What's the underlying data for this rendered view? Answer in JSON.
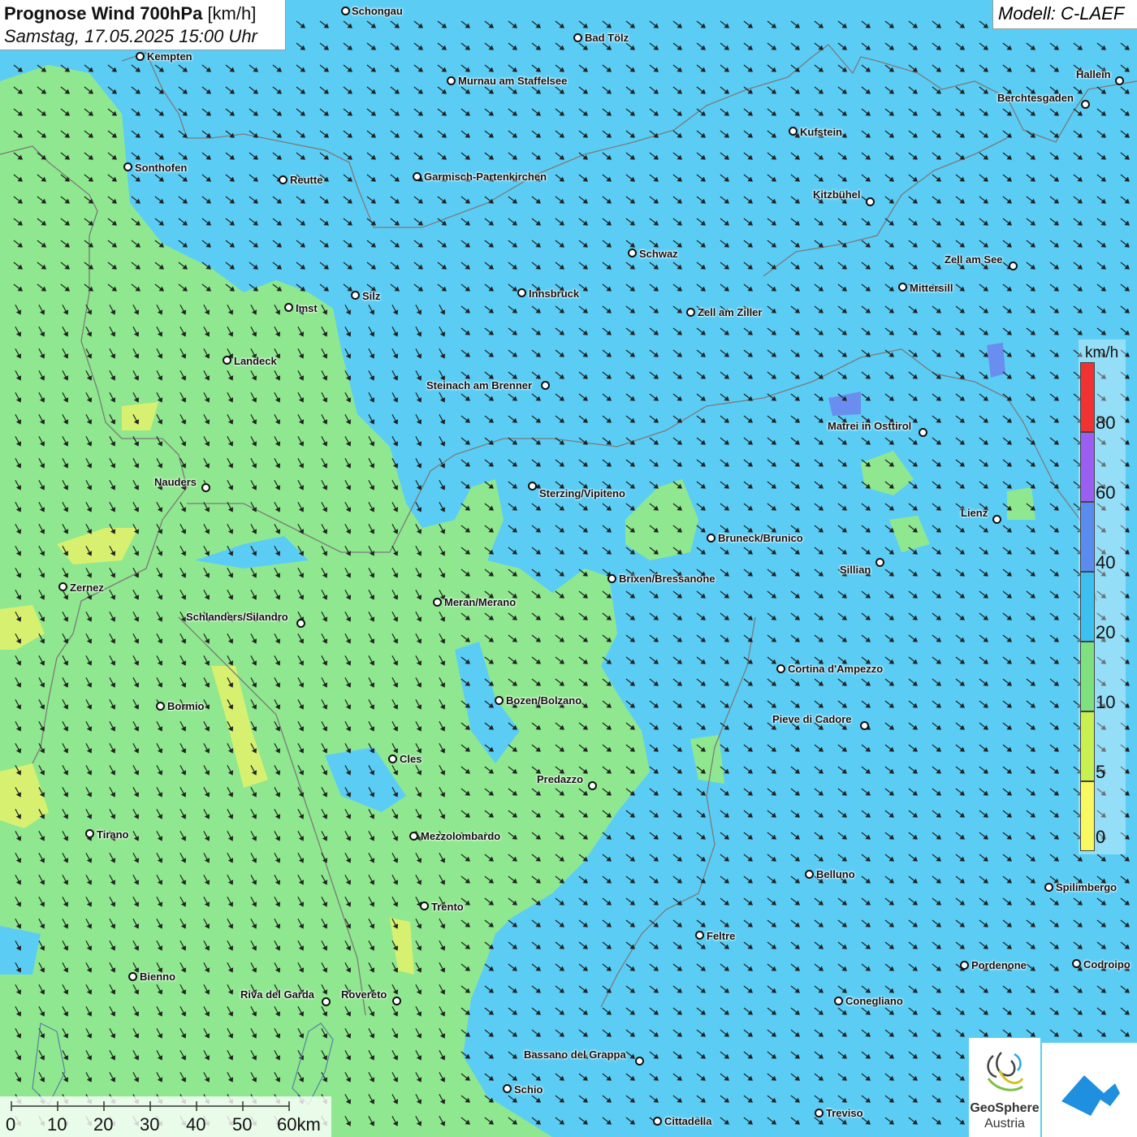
{
  "header": {
    "title_bold": "Prognose Wind 700hPa",
    "title_unit": "[km/h]",
    "datetime": "Samstag, 17.05.2025 15:00 Uhr",
    "model": "Modell: C-LAEF"
  },
  "legend": {
    "unit": "km/h",
    "ticks": [
      "80",
      "60",
      "40",
      "20",
      "10",
      "5",
      "0"
    ],
    "colors": [
      "#f03232",
      "#9a5ef0",
      "#5a8cf0",
      "#3cc0f0",
      "#7fe07f",
      "#c8f050",
      "#f8f860"
    ]
  },
  "scale": {
    "labels": [
      "0",
      "10",
      "20",
      "30",
      "40",
      "50",
      "60km"
    ]
  },
  "logos": {
    "geosphere_line1": "GeoSphere",
    "geosphere_line2": "Austria"
  },
  "cities": [
    {
      "name": "Schongau"
    },
    {
      "name": "Bad Tölz"
    },
    {
      "name": "Kempten"
    },
    {
      "name": "Murnau am Staffelsee"
    },
    {
      "name": "Hallein"
    },
    {
      "name": "Berchtesgaden"
    },
    {
      "name": "Kufstein"
    },
    {
      "name": "Sonthofen"
    },
    {
      "name": "Reutte"
    },
    {
      "name": "Garmisch-Partenkirchen"
    },
    {
      "name": "Kitzbühel"
    },
    {
      "name": "Schwaz"
    },
    {
      "name": "Zell am See"
    },
    {
      "name": "Mittersill"
    },
    {
      "name": "Innsbruck"
    },
    {
      "name": "Silz"
    },
    {
      "name": "Imst"
    },
    {
      "name": "Zell am Ziller"
    },
    {
      "name": "Landeck"
    },
    {
      "name": "Steinach am Brenner"
    },
    {
      "name": "Matrei in Osttirol"
    },
    {
      "name": "Nauders"
    },
    {
      "name": "Sterzing/Vipiteno"
    },
    {
      "name": "Lienz"
    },
    {
      "name": "Bruneck/Brunico"
    },
    {
      "name": "Sillian"
    },
    {
      "name": "Brixen/Bressanone"
    },
    {
      "name": "Zernez"
    },
    {
      "name": "Meran/Merano"
    },
    {
      "name": "Schlanders/Silandro"
    },
    {
      "name": "Cortina d'Ampezzo"
    },
    {
      "name": "Bozen/Bolzano"
    },
    {
      "name": "Bormio"
    },
    {
      "name": "Pieve di Cadore"
    },
    {
      "name": "Cles"
    },
    {
      "name": "Predazzo"
    },
    {
      "name": "Tirano"
    },
    {
      "name": "Mezzolombardo"
    },
    {
      "name": "Belluno"
    },
    {
      "name": "Spilimbergo"
    },
    {
      "name": "Trento"
    },
    {
      "name": "Feltre"
    },
    {
      "name": "Pordenone"
    },
    {
      "name": "Codroipo"
    },
    {
      "name": "Bienno"
    },
    {
      "name": "Riva del Garda"
    },
    {
      "name": "Rovereto"
    },
    {
      "name": "Conegliano"
    },
    {
      "name": "Bassano del Grappa"
    },
    {
      "name": "Schio"
    },
    {
      "name": "Treviso"
    },
    {
      "name": "Cittadella"
    }
  ]
}
